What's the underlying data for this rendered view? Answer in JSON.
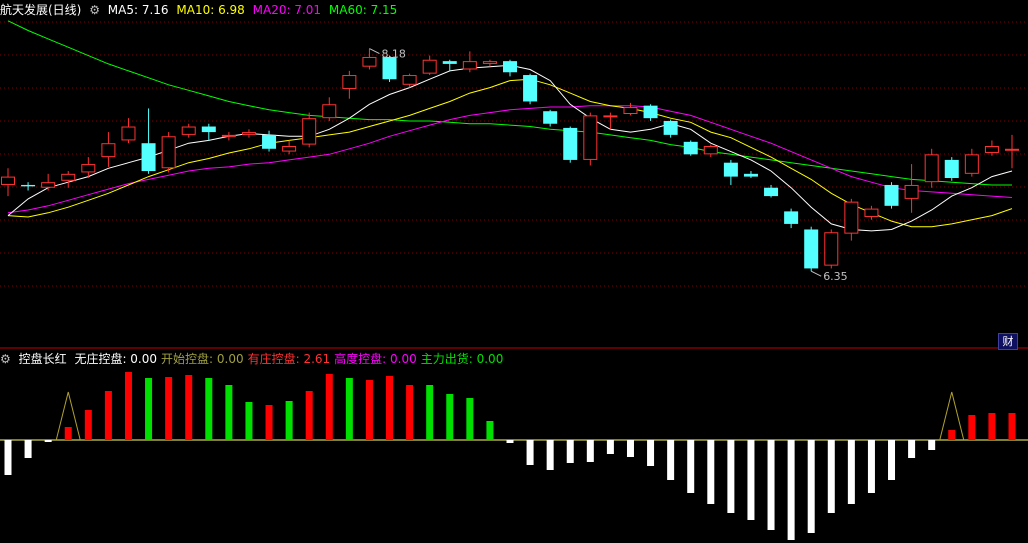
{
  "colors": {
    "up": "#ff3232",
    "down": "#54ffff",
    "ma5": "#ffffff",
    "ma10": "#ffff00",
    "ma20": "#ff00ff",
    "ma60": "#00ff00",
    "grid": "#800000",
    "volRed": "#ff0000",
    "volGreen": "#00e000",
    "volWhite": "#ffffff"
  },
  "header": {
    "title": "航天发展(日线)",
    "ma5": "MA5: 7.16",
    "ma10": "MA10: 6.98",
    "ma20": "MA20: 7.01",
    "ma60": "MA60: 7.15"
  },
  "indicator": {
    "name": "控盘长红",
    "items": [
      {
        "label": "无庄控盘:",
        "value": "0.00",
        "color": "#ffffff"
      },
      {
        "label": "开始控盘:",
        "value": "0.00",
        "color": "#a0a040"
      },
      {
        "label": "有庄控盘:",
        "value": "2.61",
        "color": "#ff3232"
      },
      {
        "label": "高度控盘:",
        "value": "0.00",
        "color": "#ff00ff"
      },
      {
        "label": "主力出货:",
        "value": "0.00",
        "color": "#00e000"
      }
    ]
  },
  "badge": "财",
  "chart_data": {
    "type": "candlestick",
    "price_range": [
      6.1,
      8.4
    ],
    "high_label": "8.18",
    "low_label": "6.35",
    "candles": [
      [
        7.2,
        7.26,
        7.12,
        7.32
      ],
      [
        7.2,
        7.19,
        7.16,
        7.22
      ],
      [
        7.18,
        7.22,
        7.16,
        7.28
      ],
      [
        7.23,
        7.28,
        7.18,
        7.3
      ],
      [
        7.29,
        7.35,
        7.25,
        7.4
      ],
      [
        7.4,
        7.5,
        7.33,
        7.58
      ],
      [
        7.52,
        7.62,
        7.5,
        7.68
      ],
      [
        7.5,
        7.3,
        7.28,
        7.75
      ],
      [
        7.32,
        7.55,
        7.29,
        7.58
      ],
      [
        7.56,
        7.62,
        7.54,
        7.64
      ],
      [
        7.62,
        7.58,
        7.52,
        7.64
      ],
      [
        7.56,
        7.56,
        7.52,
        7.58
      ],
      [
        7.56,
        7.58,
        7.54,
        7.6
      ],
      [
        7.56,
        7.46,
        7.44,
        7.59
      ],
      [
        7.44,
        7.48,
        7.42,
        7.52
      ],
      [
        7.49,
        7.68,
        7.47,
        7.72
      ],
      [
        7.68,
        7.78,
        7.66,
        7.83
      ],
      [
        7.89,
        7.99,
        7.82,
        8.02
      ],
      [
        8.05,
        8.12,
        8.03,
        8.18
      ],
      [
        8.12,
        7.96,
        7.94,
        8.13
      ],
      [
        7.92,
        7.99,
        7.9,
        8.0
      ],
      [
        8.0,
        8.1,
        7.99,
        8.13
      ],
      [
        8.09,
        8.07,
        8.02,
        8.1
      ],
      [
        8.03,
        8.09,
        8.01,
        8.16
      ],
      [
        8.07,
        8.09,
        8.05,
        8.1
      ],
      [
        8.09,
        8.01,
        7.98,
        8.1
      ],
      [
        7.99,
        7.8,
        7.78,
        8.0
      ],
      [
        7.73,
        7.64,
        7.62,
        7.74
      ],
      [
        7.61,
        7.38,
        7.36,
        7.62
      ],
      [
        7.38,
        7.7,
        7.34,
        7.72
      ],
      [
        7.69,
        7.7,
        7.6,
        7.72
      ],
      [
        7.71,
        7.76,
        7.7,
        7.79
      ],
      [
        7.77,
        7.68,
        7.66,
        7.78
      ],
      [
        7.66,
        7.56,
        7.54,
        7.67
      ],
      [
        7.51,
        7.42,
        7.41,
        7.52
      ],
      [
        7.42,
        7.48,
        7.4,
        7.49
      ],
      [
        7.36,
        7.26,
        7.2,
        7.38
      ],
      [
        7.28,
        7.26,
        7.25,
        7.3
      ],
      [
        7.18,
        7.12,
        7.11,
        7.2
      ],
      [
        7.01,
        6.92,
        6.89,
        7.03
      ],
      [
        6.88,
        6.6,
        6.58,
        6.9
      ],
      [
        6.62,
        6.86,
        6.6,
        6.88
      ],
      [
        6.85,
        7.08,
        6.8,
        7.1
      ],
      [
        6.97,
        7.03,
        6.95,
        7.05
      ],
      [
        7.2,
        7.05,
        7.03,
        7.22
      ],
      [
        7.1,
        7.2,
        7.0,
        7.35
      ],
      [
        7.22,
        7.42,
        7.18,
        7.46
      ],
      [
        7.38,
        7.25,
        7.23,
        7.4
      ],
      [
        7.28,
        7.42,
        7.26,
        7.46
      ],
      [
        7.43,
        7.48,
        7.41,
        7.52
      ],
      [
        7.45,
        7.46,
        7.32,
        7.56
      ]
    ],
    "ma5": [
      6.98,
      7.1,
      7.18,
      7.22,
      7.26,
      7.32,
      7.36,
      7.4,
      7.45,
      7.5,
      7.52,
      7.55,
      7.57,
      7.56,
      7.55,
      7.55,
      7.6,
      7.68,
      7.78,
      7.85,
      7.9,
      7.96,
      8.02,
      8.04,
      8.05,
      8.06,
      8.03,
      7.95,
      7.78,
      7.68,
      7.6,
      7.58,
      7.6,
      7.64,
      7.6,
      7.5,
      7.44,
      7.38,
      7.3,
      7.18,
      7.04,
      6.92,
      6.88,
      6.87,
      6.88,
      6.94,
      7.02,
      7.12,
      7.18,
      7.26,
      7.3
    ],
    "ma10": [
      6.98,
      6.97,
      7.0,
      7.04,
      7.09,
      7.14,
      7.2,
      7.26,
      7.31,
      7.36,
      7.39,
      7.43,
      7.46,
      7.5,
      7.52,
      7.54,
      7.56,
      7.58,
      7.62,
      7.66,
      7.7,
      7.75,
      7.8,
      7.86,
      7.9,
      7.95,
      7.96,
      7.92,
      7.86,
      7.8,
      7.77,
      7.75,
      7.72,
      7.68,
      7.65,
      7.58,
      7.54,
      7.47,
      7.4,
      7.32,
      7.24,
      7.14,
      7.06,
      7.0,
      6.94,
      6.9,
      6.9,
      6.92,
      6.95,
      6.98,
      7.03
    ],
    "ma20": [
      7.0,
      7.02,
      7.05,
      7.09,
      7.13,
      7.17,
      7.21,
      7.24,
      7.27,
      7.3,
      7.32,
      7.33,
      7.35,
      7.36,
      7.38,
      7.4,
      7.42,
      7.46,
      7.5,
      7.55,
      7.59,
      7.63,
      7.67,
      7.7,
      7.72,
      7.74,
      7.75,
      7.76,
      7.76,
      7.77,
      7.77,
      7.77,
      7.76,
      7.73,
      7.7,
      7.65,
      7.6,
      7.55,
      7.5,
      7.44,
      7.38,
      7.32,
      7.26,
      7.22,
      7.18,
      7.16,
      7.15,
      7.14,
      7.13,
      7.12,
      7.11
    ],
    "ma60": [
      8.38,
      8.31,
      8.25,
      8.19,
      8.13,
      8.07,
      8.02,
      7.97,
      7.92,
      7.88,
      7.84,
      7.8,
      7.77,
      7.74,
      7.72,
      7.7,
      7.69,
      7.68,
      7.67,
      7.67,
      7.66,
      7.66,
      7.65,
      7.64,
      7.64,
      7.63,
      7.62,
      7.6,
      7.59,
      7.58,
      7.56,
      7.54,
      7.52,
      7.49,
      7.47,
      7.44,
      7.42,
      7.4,
      7.38,
      7.36,
      7.34,
      7.32,
      7.3,
      7.28,
      7.26,
      7.24,
      7.23,
      7.22,
      7.21,
      7.2,
      7.2
    ],
    "indicator_range": [
      -1.0,
      0.7
    ],
    "indicator_values": [
      -0.35,
      -0.18,
      -0.02,
      0.13,
      0.3,
      0.49,
      0.68,
      0.62,
      0.63,
      0.65,
      0.62,
      0.55,
      0.38,
      0.35,
      0.39,
      0.49,
      0.66,
      0.62,
      0.6,
      0.64,
      0.55,
      0.55,
      0.46,
      0.42,
      0.19,
      -0.03,
      -0.25,
      -0.3,
      -0.23,
      -0.22,
      -0.14,
      -0.17,
      -0.26,
      -0.4,
      -0.53,
      -0.64,
      -0.73,
      -0.8,
      -0.9,
      -1.0,
      -0.93,
      -0.73,
      -0.64,
      -0.53,
      -0.4,
      -0.18,
      -0.1,
      0.1,
      0.25,
      0.27,
      0.27
    ],
    "indicator_colors": [
      "white",
      "white",
      "white",
      "red",
      "red",
      "red",
      "red",
      "green",
      "red",
      "red",
      "green",
      "green",
      "green",
      "red",
      "green",
      "red",
      "red",
      "green",
      "red",
      "red",
      "red",
      "green",
      "green",
      "green",
      "green",
      "white",
      "white",
      "white",
      "white",
      "white",
      "white",
      "white",
      "white",
      "white",
      "white",
      "white",
      "white",
      "white",
      "white",
      "white",
      "white",
      "white",
      "white",
      "white",
      "white",
      "white",
      "white",
      "red",
      "red",
      "red",
      "red"
    ]
  }
}
